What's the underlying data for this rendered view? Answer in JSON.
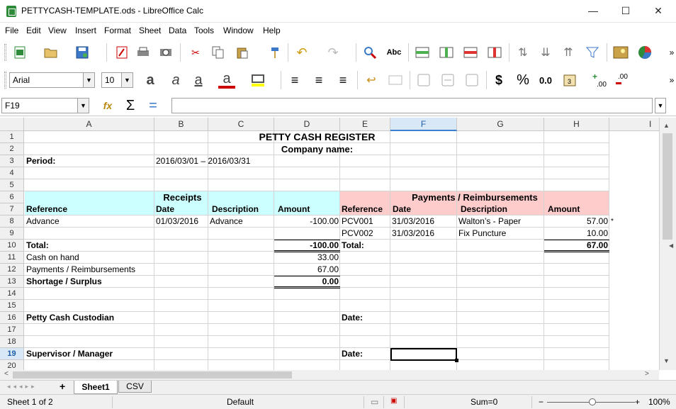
{
  "window": {
    "title": "PETTYCASH-TEMPLATE.ods - LibreOffice Calc",
    "minimize": "—",
    "maximize": "☐",
    "close": "✕"
  },
  "menu": [
    "File",
    "Edit",
    "View",
    "Insert",
    "Format",
    "Sheet",
    "Data",
    "Tools",
    "Window",
    "Help"
  ],
  "toolbar2": {
    "font_name": "Arial",
    "font_size": "10",
    "currency": "$",
    "percent": "%",
    "number": "0.0",
    "add_decimal": ".00",
    "del_decimal": ".00"
  },
  "formula_bar": {
    "name_box": "F19",
    "content": ""
  },
  "columns": [
    "A",
    "B",
    "C",
    "D",
    "E",
    "F",
    "G",
    "H",
    "I"
  ],
  "selected_column": "F",
  "rows": [
    "1",
    "2",
    "3",
    "4",
    "5",
    "6",
    "7",
    "8",
    "9",
    "10",
    "11",
    "12",
    "13",
    "14",
    "15",
    "16",
    "17",
    "18",
    "19",
    "20"
  ],
  "selected_row": "19",
  "sheet": {
    "title": "PETTY CASH REGISTER",
    "company": "Company name:",
    "period_label": "Period:",
    "period_value": "2016/03/01 – 2016/03/31",
    "receipts_header": "Receipts",
    "payments_header": "Payments / Reimbursements",
    "col_reference": "Reference",
    "col_date": "Date",
    "col_description": "Description",
    "col_amount": "Amount",
    "receipts": [
      {
        "reference": "Advance",
        "date": "01/03/2016",
        "description": "Advance",
        "amount": "-100.00"
      }
    ],
    "payments": [
      {
        "reference": "PCV001",
        "date": "31/03/2016",
        "description": "Walton’s - Paper",
        "amount": "57.00"
      },
      {
        "reference": "PCV002",
        "date": "31/03/2016",
        "description": "Fix Puncture",
        "amount": "10.00"
      }
    ],
    "note_marker": "*",
    "total_label": "Total:",
    "receipts_total": "-100.00",
    "payments_total": "67.00",
    "cash_on_hand_label": "Cash on hand",
    "cash_on_hand": "33.00",
    "payments_reimb_label": "Payments / Reimbursements",
    "payments_reimb": "67.00",
    "shortage_label": "Shortage / Surplus",
    "shortage": "0.00",
    "custodian_label": "Petty Cash Custodian",
    "supervisor_label": "Supervisor / Manager",
    "date_label": "Date:"
  },
  "tabs": [
    "Sheet1",
    "CSV"
  ],
  "active_tab": "Sheet1",
  "status": {
    "sheet_of": "Sheet 1 of 2",
    "page_style": "Default",
    "sum": "Sum=0",
    "zoom": "100%"
  }
}
